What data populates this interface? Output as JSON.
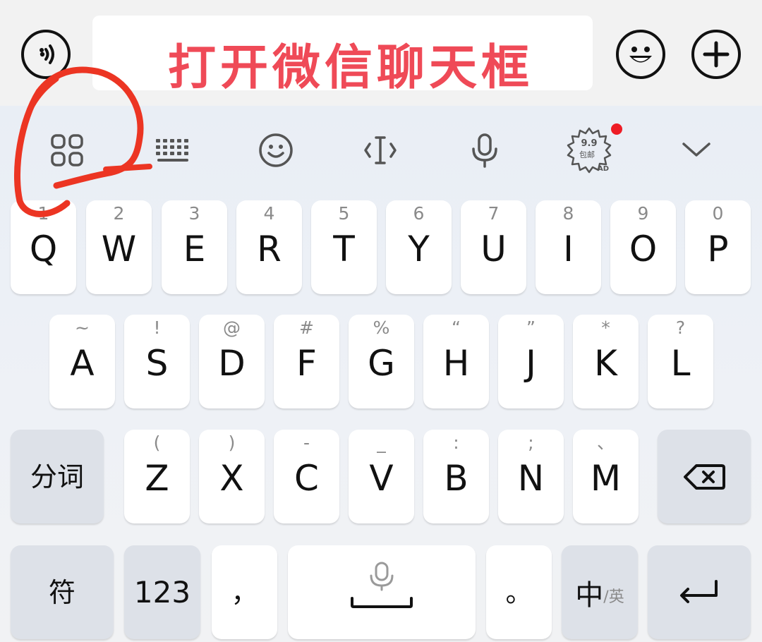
{
  "annotation": {
    "text": "打开微信聊天框",
    "color": "#ef4a57",
    "circle_color": "#ec3523"
  },
  "chat_bar": {
    "voice_icon": "voice-input-icon",
    "emoji_icon": "emoji-icon",
    "plus_icon": "plus-icon"
  },
  "toolbar": {
    "items": [
      "apps-grid-icon",
      "keyboard-icon",
      "emoji-icon",
      "text-cursor-icon",
      "microphone-icon",
      "ad-badge-icon",
      "collapse-chevron-icon"
    ],
    "ad_badge": {
      "top": "9.9",
      "middle": "包邮",
      "bottom": "AD"
    },
    "notification_dot_color": "#ee1c25"
  },
  "keys": {
    "row1": [
      {
        "main": "Q",
        "hint": "1"
      },
      {
        "main": "W",
        "hint": "2"
      },
      {
        "main": "E",
        "hint": "3"
      },
      {
        "main": "R",
        "hint": "4"
      },
      {
        "main": "T",
        "hint": "5"
      },
      {
        "main": "Y",
        "hint": "6"
      },
      {
        "main": "U",
        "hint": "7"
      },
      {
        "main": "I",
        "hint": "8"
      },
      {
        "main": "O",
        "hint": "9"
      },
      {
        "main": "P",
        "hint": "0"
      }
    ],
    "row2": [
      {
        "main": "A",
        "hint": "~"
      },
      {
        "main": "S",
        "hint": "!"
      },
      {
        "main": "D",
        "hint": "@"
      },
      {
        "main": "F",
        "hint": "#"
      },
      {
        "main": "G",
        "hint": "%"
      },
      {
        "main": "H",
        "hint": "“"
      },
      {
        "main": "J",
        "hint": "”"
      },
      {
        "main": "K",
        "hint": "*"
      },
      {
        "main": "L",
        "hint": "?"
      }
    ],
    "row3": [
      {
        "main": "Z",
        "hint": "("
      },
      {
        "main": "X",
        "hint": ")"
      },
      {
        "main": "C",
        "hint": "-"
      },
      {
        "main": "V",
        "hint": "_"
      },
      {
        "main": "B",
        "hint": ":"
      },
      {
        "main": "N",
        "hint": ";"
      },
      {
        "main": "M",
        "hint": "、"
      }
    ],
    "segment_label": "分词",
    "symbols_label": "符",
    "numbers_label": "123",
    "comma_label": "，",
    "period_label": "。",
    "lang_primary": "中",
    "lang_secondary": "/英"
  }
}
